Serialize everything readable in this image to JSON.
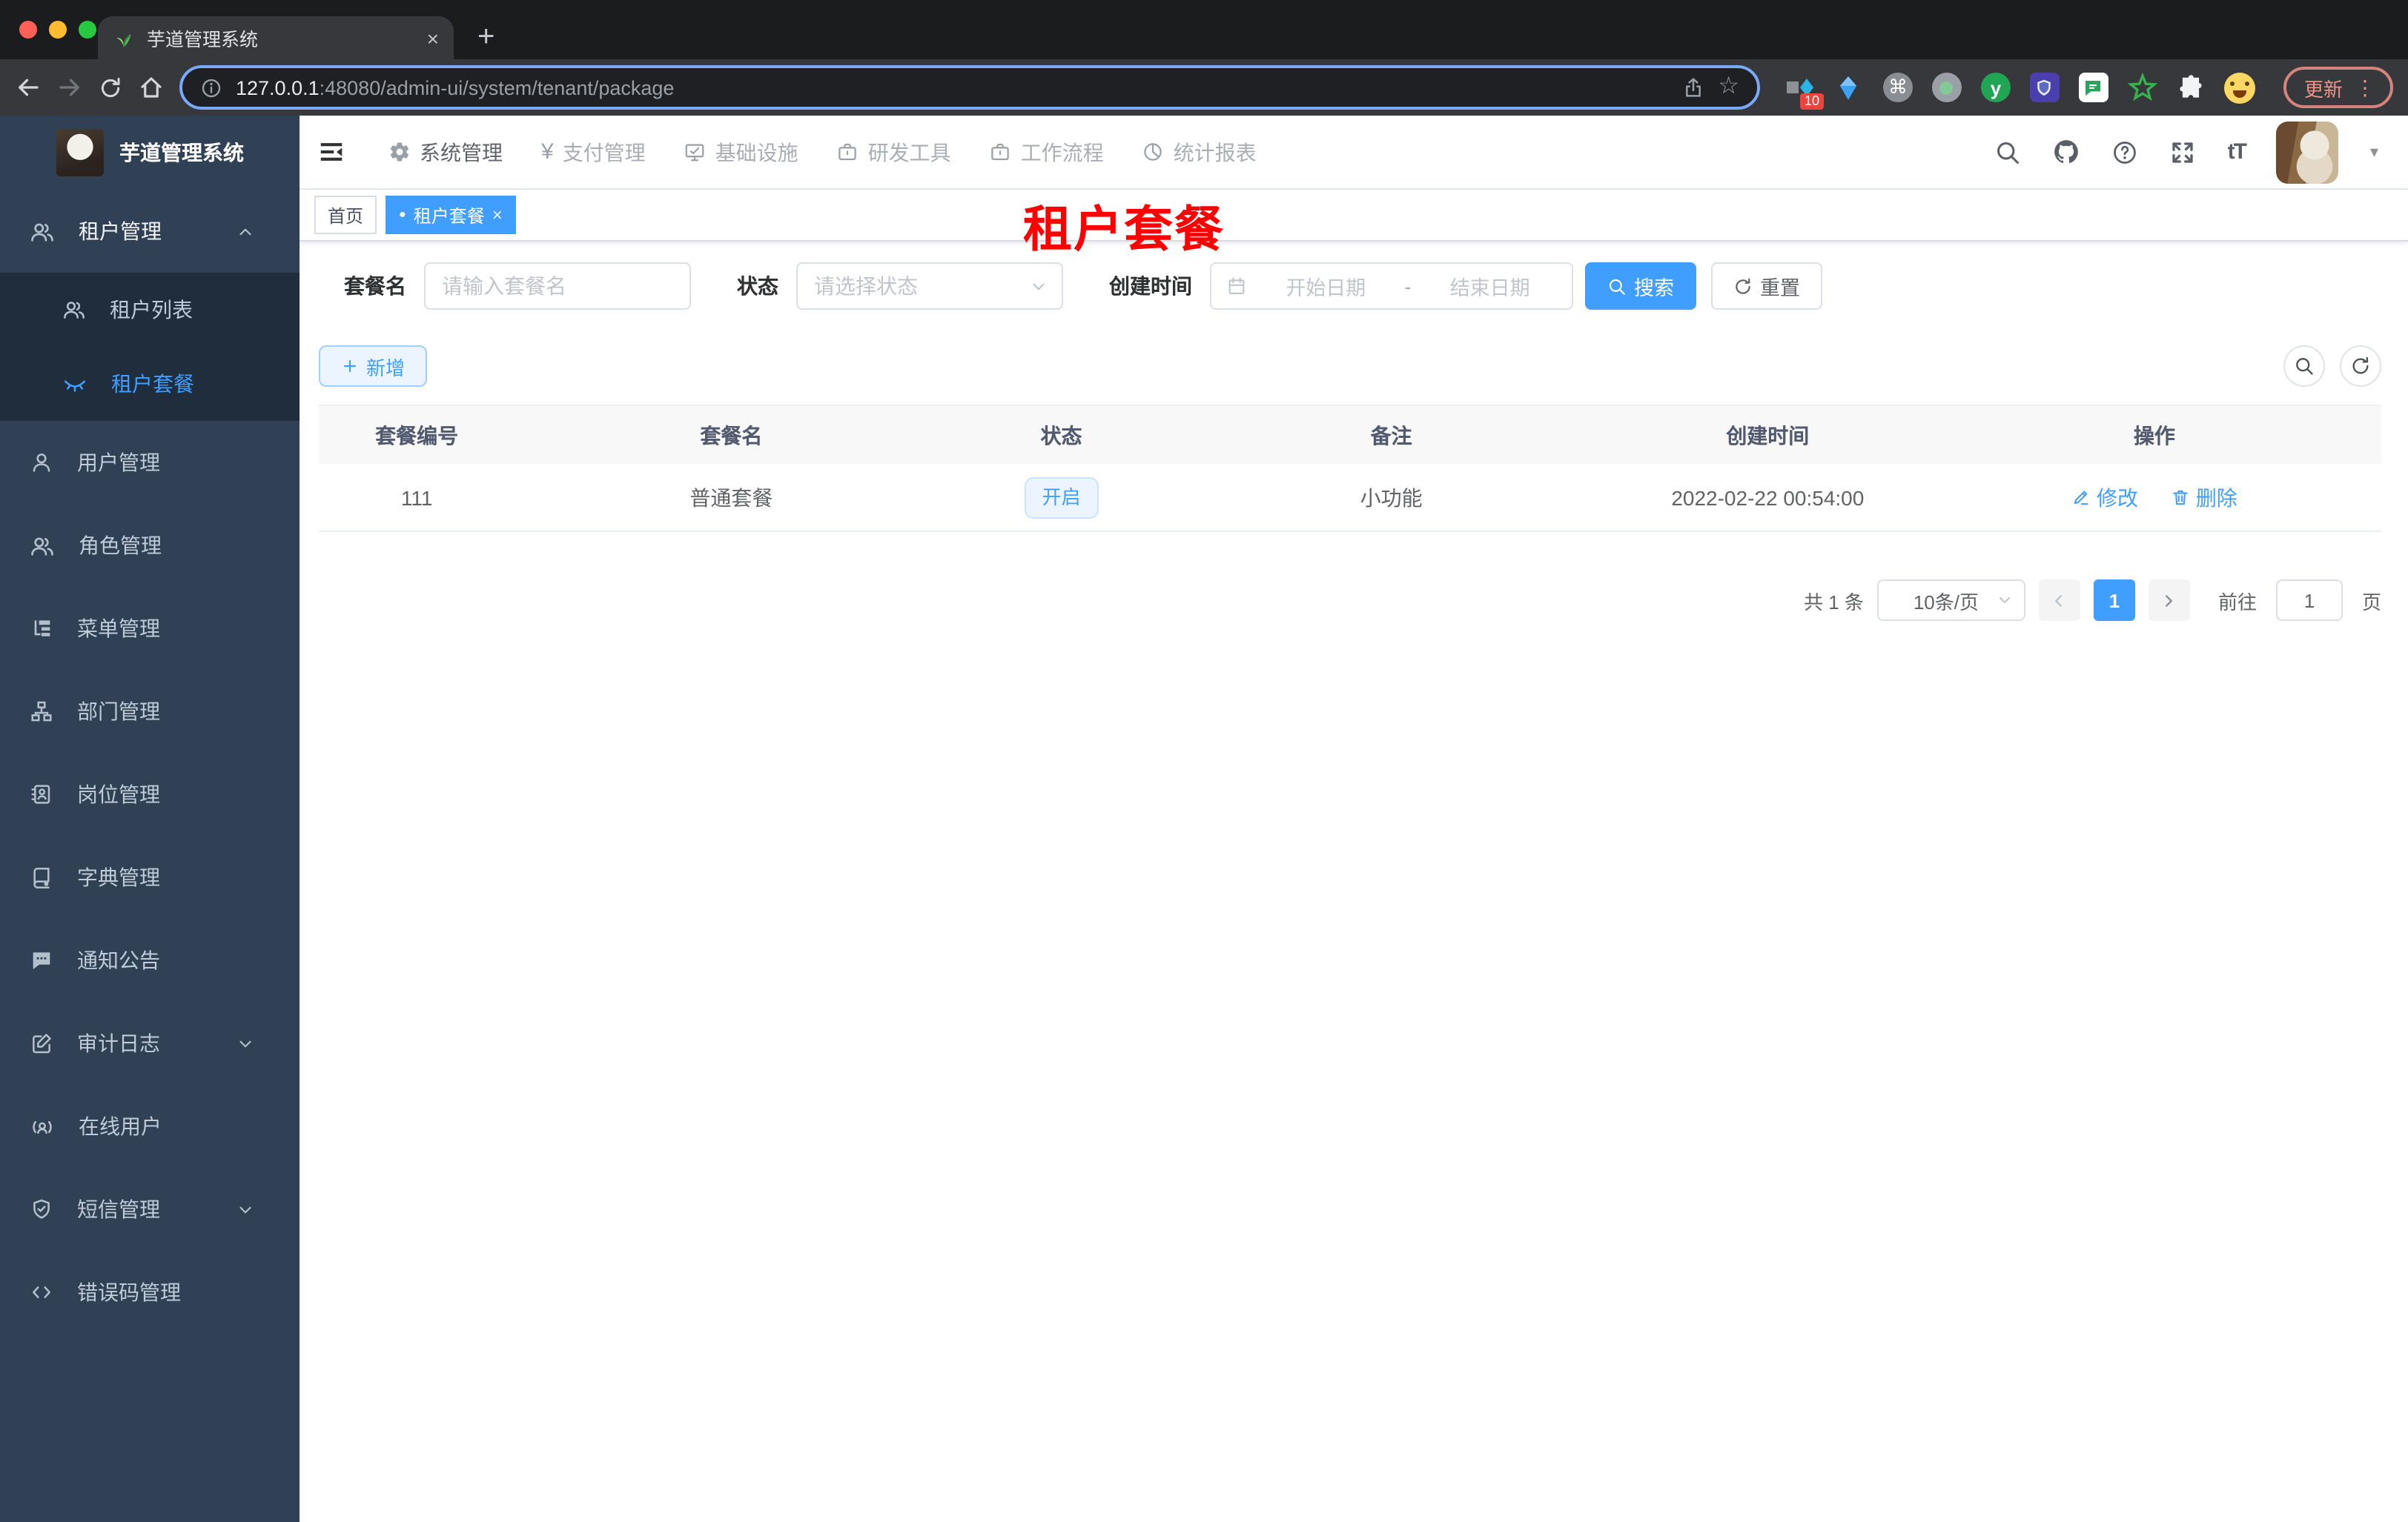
{
  "browser": {
    "tab_title": "芋道管理系统",
    "url_host": "127.0.0.1",
    "url_path": ":48080/admin-ui/system/tenant/package",
    "update_label": "更新",
    "extension_badge": "10",
    "extension_y": "y"
  },
  "glyphs": {
    "close": "×",
    "new_tab": "+",
    "yen": "¥",
    "kebab": "⋮",
    "caret": "▾",
    "dot": "●",
    "font_size": "tT",
    "star": "☆",
    "command": "⌘"
  },
  "app": {
    "logo_title": "芋道管理系统",
    "topnav": {
      "items": [
        {
          "label": "系统管理"
        },
        {
          "label": "支付管理"
        },
        {
          "label": "基础设施"
        },
        {
          "label": "研发工具"
        },
        {
          "label": "工作流程"
        },
        {
          "label": "统计报表"
        }
      ]
    },
    "sidebar": {
      "items": [
        {
          "label": "租户管理"
        },
        {
          "label": "租户列表"
        },
        {
          "label": "租户套餐"
        },
        {
          "label": "用户管理"
        },
        {
          "label": "角色管理"
        },
        {
          "label": "菜单管理"
        },
        {
          "label": "部门管理"
        },
        {
          "label": "岗位管理"
        },
        {
          "label": "字典管理"
        },
        {
          "label": "通知公告"
        },
        {
          "label": "审计日志"
        },
        {
          "label": "在线用户"
        },
        {
          "label": "短信管理"
        },
        {
          "label": "错误码管理"
        }
      ]
    },
    "tags": {
      "home": "首页",
      "active": "租户套餐"
    },
    "overlay_title": "租户套餐",
    "filters": {
      "name_label": "套餐名",
      "name_placeholder": "请输入套餐名",
      "status_label": "状态",
      "status_placeholder": "请选择状态",
      "date_label": "创建时间",
      "date_start_placeholder": "开始日期",
      "date_separator": "-",
      "date_end_placeholder": "结束日期",
      "search_label": "搜索",
      "reset_label": "重置"
    },
    "toolbar": {
      "add_label": "新增"
    },
    "table": {
      "headers": [
        "套餐编号",
        "套餐名",
        "状态",
        "备注",
        "创建时间",
        "操作"
      ],
      "rows": [
        {
          "id": "111",
          "name": "普通套餐",
          "status": "开启",
          "remark": "小功能",
          "created": "2022-02-22 00:54:00",
          "edit_label": "修改",
          "delete_label": "删除"
        }
      ]
    },
    "pagination": {
      "total": "共 1 条",
      "page_size": "10条/页",
      "current_page": "1",
      "goto_label": "前往",
      "goto_value": "1",
      "page_suffix": "页"
    }
  }
}
